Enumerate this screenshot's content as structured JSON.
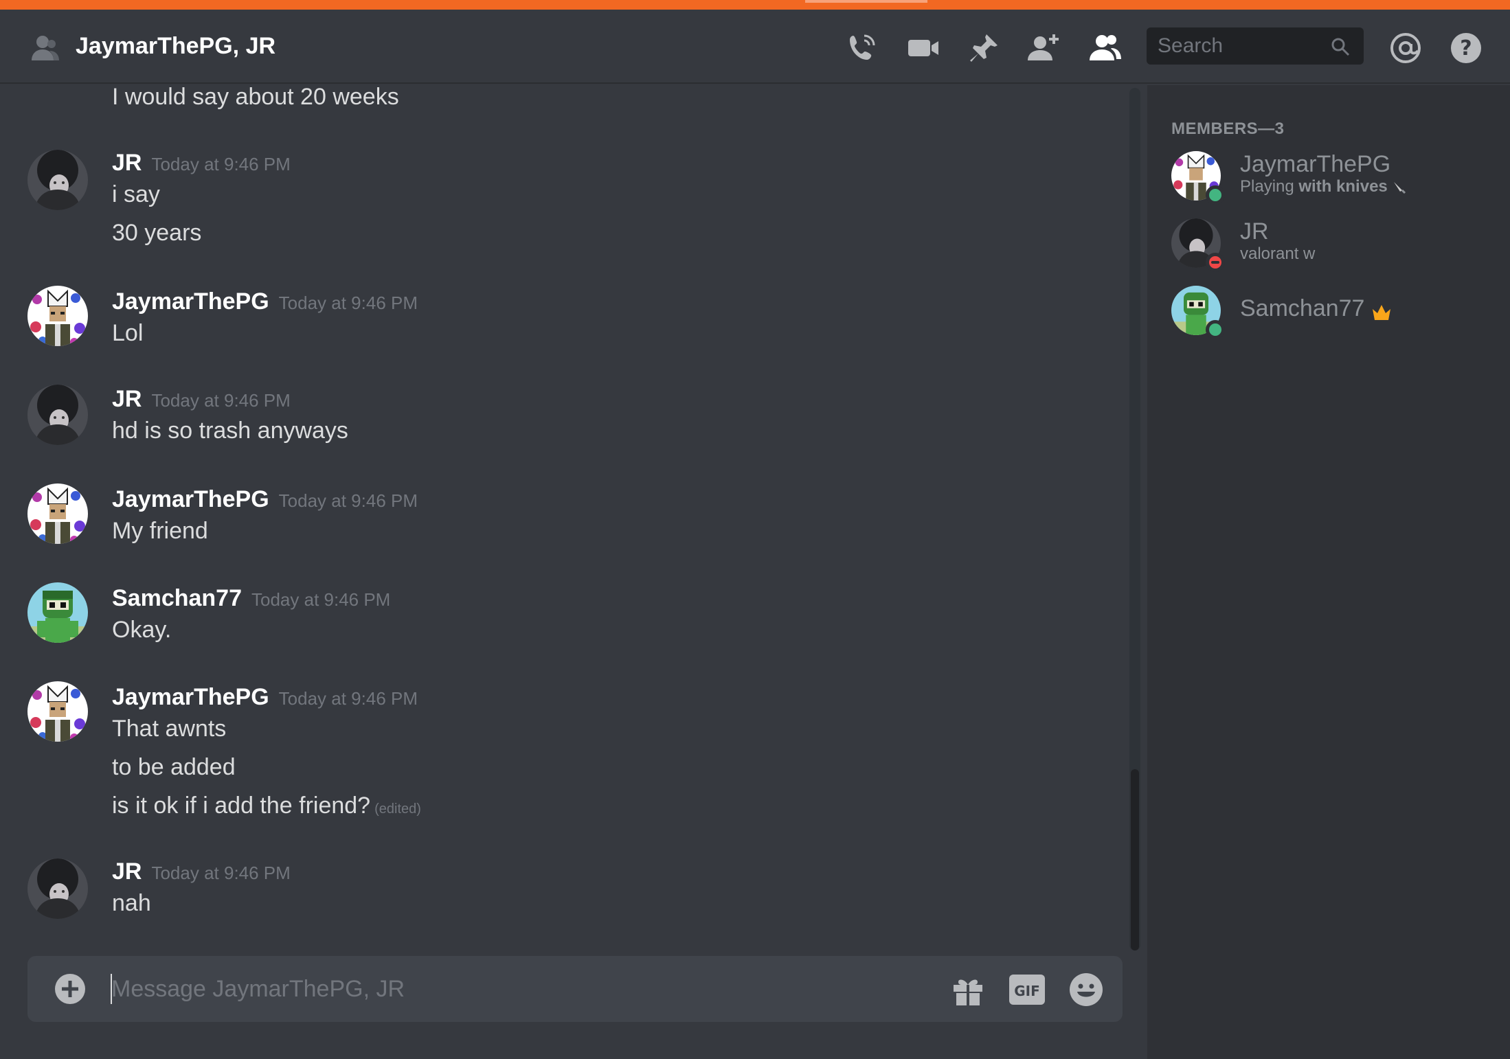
{
  "header": {
    "title": "JaymarThePG, JR",
    "search_placeholder": "Search",
    "icons": [
      "call-icon",
      "video-icon",
      "pin-icon",
      "add-friend-icon",
      "members-icon",
      "mention-icon",
      "help-icon"
    ]
  },
  "messages": [
    {
      "lines": [
        "I would say about 20 weeks"
      ]
    },
    {
      "author": "JR",
      "timestamp": "Today at 9:46 PM",
      "lines": [
        "i say",
        "30 years"
      ]
    },
    {
      "author": "JaymarThePG",
      "timestamp": "Today at 9:46 PM",
      "lines": [
        "Lol"
      ]
    },
    {
      "author": "JR",
      "timestamp": "Today at 9:46 PM",
      "lines": [
        "hd is so trash anyways"
      ]
    },
    {
      "author": "JaymarThePG",
      "timestamp": "Today at 9:46 PM",
      "lines": [
        "My friend"
      ]
    },
    {
      "author": "Samchan77",
      "timestamp": "Today at 9:46 PM",
      "lines": [
        "Okay."
      ]
    },
    {
      "author": "JaymarThePG",
      "timestamp": "Today at 9:46 PM",
      "lines": [
        "That awnts",
        "to be added",
        "is it ok if i add the friend?"
      ],
      "edited": "(edited)"
    },
    {
      "author": "JR",
      "timestamp": "Today at 9:46 PM",
      "lines": [
        "nah"
      ]
    }
  ],
  "composer": {
    "placeholder": "Message JaymarThePG, JR",
    "gif_label": "GIF"
  },
  "members": {
    "heading": "MEMBERS—3",
    "list": [
      {
        "name": "JaymarThePG",
        "activity_prefix": "Playing",
        "activity_name": "with knives",
        "status": "online",
        "status_color": "#43b581"
      },
      {
        "name": "JR",
        "activity_prefix": "",
        "activity_name": "valorant w",
        "status": "dnd",
        "status_color": "#f04747"
      },
      {
        "name": "Samchan77",
        "activity_prefix": "",
        "activity_name": "",
        "status": "online",
        "status_color": "#43b581",
        "owner": true
      }
    ]
  },
  "colors": {
    "accent_stripe": "#f26822",
    "background": "#36393f",
    "sidebar": "#2f3136",
    "owner_crown": "#faa61a"
  }
}
